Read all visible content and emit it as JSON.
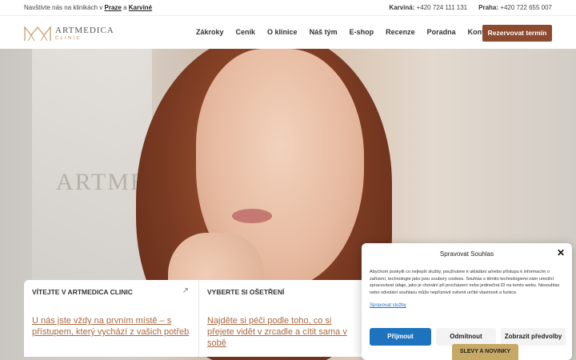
{
  "topbar": {
    "visit_prefix": "Navštivte nás na klinikách v",
    "city1": "Praze",
    "conj": "a",
    "city2": "Karviné",
    "phones": [
      {
        "label": "Karviná:",
        "number": "+420 724 111 131"
      },
      {
        "label": "Praha:",
        "number": "+420 722 655 007"
      }
    ]
  },
  "logo": {
    "name": "ARTMEDICA",
    "sub": "CLINIC"
  },
  "nav": {
    "items": [
      "Zákroky",
      "Ceník",
      "O klinice",
      "Náš tým",
      "E-shop",
      "Recenze",
      "Poradna",
      "Kontakt"
    ],
    "cta": "Rezervovat termín"
  },
  "hero": {
    "ghost_brand": "ARTMEDICA"
  },
  "cards": [
    {
      "title": "VÍTEJTE V ARTMEDICA CLINIC",
      "text": "U nás jste vždy na prvním místě – s přístupem, který vychází z vašich potřeb"
    },
    {
      "title": "VYBERTE SI OŠETŘENÍ",
      "text": "Najděte si péči podle toho, co si přejete vidět v zrcadle a cítit sama v sobě"
    }
  ],
  "consent": {
    "title": "Spravovat Souhlas",
    "body": "Abychom poskytli co nejlepší služby, používáme k ukládání a/nebo přístupu k informacím o zařízení, technologie jako jsou soubory cookies. Souhlas s těmito technologiemi nám umožní zpracovávat údaje, jako je chování při procházení nebo jedinečná ID na tomto webu. Nesouhlas nebo odvolání souhlasu může nepříznivě ovlivnit určité vlastnosti a funkce.",
    "manage_link": "Spravovat služby",
    "accept": "Přijmout",
    "deny": "Odmítnout",
    "prefs": "Zobrazit předvolby"
  },
  "promo": {
    "label": "SLEVY A NOVINKY"
  },
  "colors": {
    "brand": "#8c4a2f",
    "link": "#a86a43",
    "accept": "#1e73be",
    "promo": "#c7a865"
  }
}
